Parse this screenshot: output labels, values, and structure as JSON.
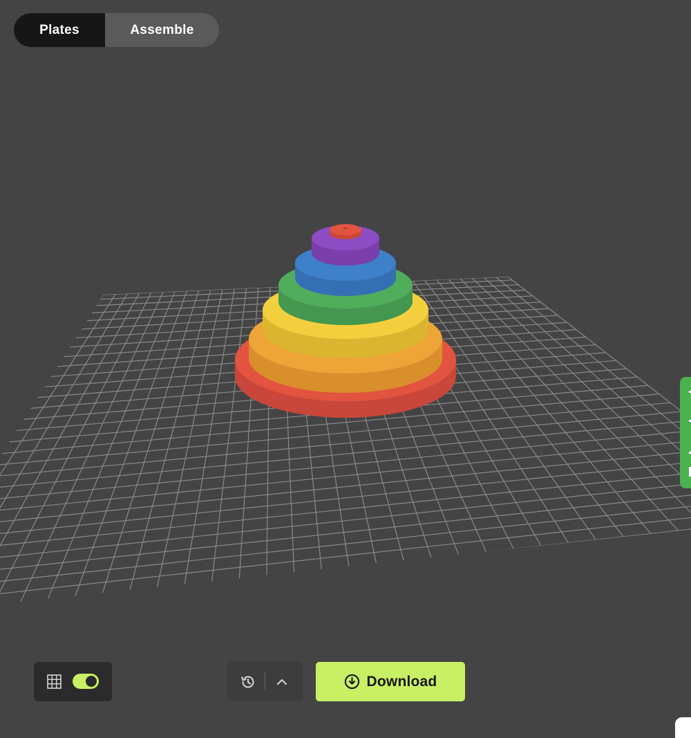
{
  "mode_toggle": {
    "plates_label": "Plates",
    "assemble_label": "Assemble",
    "active": "Plates"
  },
  "scene": {
    "object": "stacked-ring-pyramid",
    "ring_colors": [
      "#e2543f",
      "#eea437",
      "#f3cf3e",
      "#4fad5b",
      "#3f80ca",
      "#8d4cc4",
      "#e2543f"
    ],
    "grid_color": "#8a8a8a",
    "background": "#444444"
  },
  "grid_toggle": {
    "icon": "grid-icon",
    "enabled": true,
    "accent": "#c9f065"
  },
  "history": {
    "icon": "history-icon",
    "expand_icon": "chevron-up-icon"
  },
  "download": {
    "label": "Download",
    "icon": "download-circle-icon",
    "color": "#c9f065"
  },
  "side_tab": {
    "color": "#4caf50"
  }
}
